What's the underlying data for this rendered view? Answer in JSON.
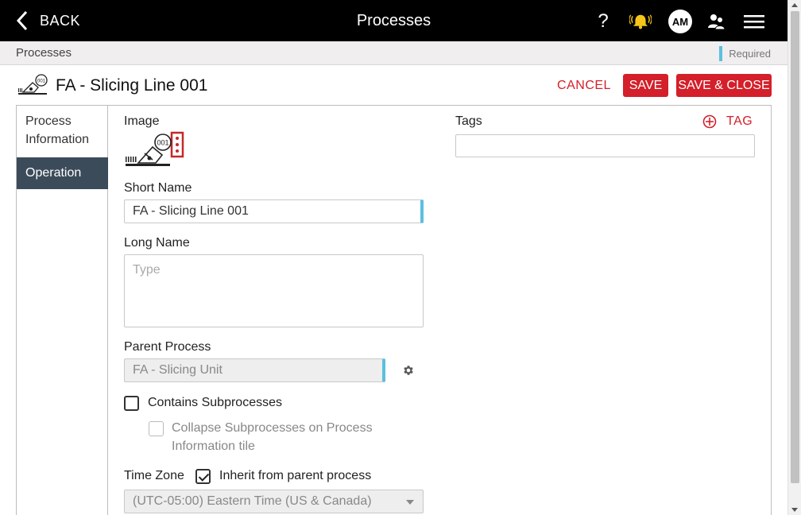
{
  "topbar": {
    "back_label": "BACK",
    "title": "Processes",
    "help_glyph": "?",
    "avatar_initials": "AM"
  },
  "breadcrumb": {
    "current": "Processes",
    "required_label": "Required"
  },
  "header": {
    "process_title": "FA - Slicing Line 001",
    "cancel_label": "CANCEL",
    "save_label": "SAVE",
    "save_close_label": "SAVE & CLOSE"
  },
  "side_nav": {
    "items": [
      {
        "label": "Process Information",
        "active": false
      },
      {
        "label": "Operation",
        "active": true
      }
    ]
  },
  "form": {
    "image_label": "Image",
    "short_name_label": "Short Name",
    "short_name_value": "FA - Slicing Line 001",
    "long_name_label": "Long Name",
    "long_name_placeholder": "Type",
    "parent_process_label": "Parent Process",
    "parent_process_value": "FA - Slicing Unit",
    "contains_subprocesses_label": "Contains Subprocesses",
    "collapse_subprocesses_label": "Collapse Subprocesses on Process Information tile",
    "time_zone_label": "Time Zone",
    "inherit_label": "Inherit from parent process",
    "inherit_checked": true,
    "time_zone_value": "(UTC-05:00) Eastern Time (US & Canada)",
    "tags_label": "Tags",
    "tag_button_label": "TAG"
  },
  "colors": {
    "accent_red": "#d3202a",
    "required_blue": "#5bc0de",
    "nav_active": "#3c4b5a",
    "bell_yellow": "#f5c518"
  },
  "icons": [
    "chevron-left-icon",
    "help-icon",
    "bell-icon",
    "avatar",
    "users-icon",
    "hamburger-menu-icon",
    "slicer-machine-icon",
    "gear-icon",
    "add-circle-icon",
    "dropdown-caret-icon"
  ]
}
